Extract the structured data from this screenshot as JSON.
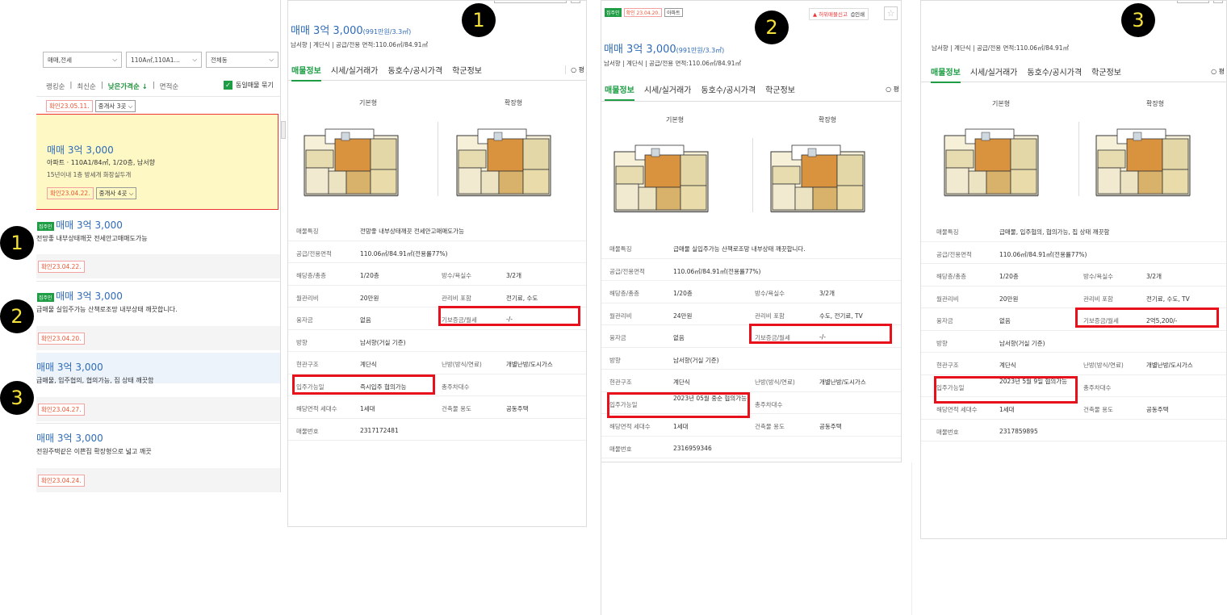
{
  "markers": [
    "1",
    "2",
    "3"
  ],
  "list": {
    "filters": [
      "매매,전세",
      "110A㎡,110A1…",
      "전체동"
    ],
    "sort": [
      "랭킹순",
      "최신순",
      "낮은가격순 ↓",
      "면적순"
    ],
    "same_listing": "동일매물 묶기",
    "top_confirm": "확인23.05.11.",
    "top_agent": "중개사 3곳",
    "highlight": {
      "price": "매매 3억 3,000",
      "desc": "아파트 · 110A1/84㎡, 1/20층, 남서향",
      "tags": "15년이내  1층  방세개  화장실두개",
      "confirm": "확인23.04.22.",
      "agent": "중개사 4곳"
    },
    "items": [
      {
        "badge": "집주인",
        "price": "매매 3억 3,000",
        "desc": "전망좋 내부상태깨끗 전세안고매매도가능",
        "confirm": "확인23.04.22."
      },
      {
        "badge": "집주인",
        "price": "매매 3억 3,000",
        "desc": "급매물 실입주가능 산책로조망 내부상태 깨끗합니다.",
        "confirm": "확인23.04.20."
      },
      {
        "badge": "",
        "price": "매매 3억 3,000",
        "desc": "급매물, 입주협의, 협의가능, 집 상태 깨끗함",
        "confirm": "확인23.04.27."
      },
      {
        "badge": "",
        "price": "매매 3억 3,000",
        "desc": "전원주택같은 이쁜집 확장형으로 넓고 깨끗",
        "confirm": "확인23.04.24."
      }
    ]
  },
  "common": {
    "price": "매매 3억 3,000",
    "price_unit": "(991만원/3.3㎡)",
    "subline": "남서향 | 계단식 | 공급/전용 면적:110.06㎡/84.91㎡",
    "tabs": [
      "매물정보",
      "시세/실거래가",
      "동호수/공시가격",
      "학군정보"
    ],
    "fp_basic": "기본형",
    "fp_ext": "확장형",
    "tab_extra": "○ 평"
  },
  "panel1": {
    "rows": [
      [
        "매물특징",
        "전망좋 내부상태깨끗 전세안고매매도가능",
        "",
        ""
      ],
      [
        "공급/전용면적",
        "110.06㎡/84.91㎡(전용률77%)",
        "",
        ""
      ],
      [
        "해당층/총층",
        "1/20층",
        "방수/욕실수",
        "3/2개"
      ],
      [
        "월관리비",
        "20만원",
        "관리비 포함",
        "전기료, 수도"
      ],
      [
        "융자금",
        "없음",
        "기보증금/월세",
        "-/-"
      ],
      [
        "방향",
        "남서향(거실 기준)",
        "",
        ""
      ],
      [
        "현관구조",
        "계단식",
        "난방(방식/연료)",
        "개별난방/도시가스"
      ],
      [
        "입주가능일",
        "즉시입주 협의가능",
        "총주차대수",
        ""
      ],
      [
        "해당면적 세대수",
        "1세대",
        "건축물 용도",
        "공동주택"
      ],
      [
        "매물번호",
        "2317172481",
        "",
        ""
      ]
    ]
  },
  "panel2": {
    "tag1": "집주인",
    "tag2": "확인 23.04.20.",
    "tag3": "아파트",
    "report": "허위매물신고",
    "print": "인쇄",
    "rows": [
      [
        "매물특징",
        "급매물 실입주가능 산책로조망 내부상태 깨끗합니다.",
        "",
        ""
      ],
      [
        "공급/전용면적",
        "110.06㎡/84.91㎡(전용률77%)",
        "",
        ""
      ],
      [
        "해당층/총층",
        "1/20층",
        "방수/욕실수",
        "3/2개"
      ],
      [
        "월관리비",
        "24만원",
        "관리비 포함",
        "수도, 전기료, TV"
      ],
      [
        "융자금",
        "없음",
        "기보증금/월세",
        "-/-"
      ],
      [
        "방향",
        "남서향(거실 기준)",
        "",
        ""
      ],
      [
        "현관구조",
        "계단식",
        "난방(방식/연료)",
        "개별난방/도시가스"
      ],
      [
        "입주가능일",
        "2023년 05월 중순 협의가능",
        "총주차대수",
        ""
      ],
      [
        "해당면적 세대수",
        "1세대",
        "건축물 용도",
        "공동주택"
      ],
      [
        "매물번호",
        "2316959346",
        "",
        ""
      ]
    ]
  },
  "panel3": {
    "rows": [
      [
        "매물특징",
        "급매물, 입주협의, 협의가능, 집 상태 깨끗함",
        "",
        ""
      ],
      [
        "공급/전용면적",
        "110.06㎡/84.91㎡(전용률77%)",
        "",
        ""
      ],
      [
        "해당층/총층",
        "1/20층",
        "방수/욕실수",
        "3/2개"
      ],
      [
        "월관리비",
        "20만원",
        "관리비 포함",
        "전기료, 수도, TV"
      ],
      [
        "융자금",
        "없음",
        "기보증금/월세",
        "2억5,200/-"
      ],
      [
        "방향",
        "남서향(거실 기준)",
        "",
        ""
      ],
      [
        "현관구조",
        "계단식",
        "난방(방식/연료)",
        "개별난방/도시가스"
      ],
      [
        "입주가능일",
        "2023년 5월 9일 협의가능",
        "총주차대수",
        ""
      ],
      [
        "해당면적 세대수",
        "1세대",
        "건축물 용도",
        "공동주택"
      ],
      [
        "매물번호",
        "2317859895",
        "",
        ""
      ]
    ]
  }
}
